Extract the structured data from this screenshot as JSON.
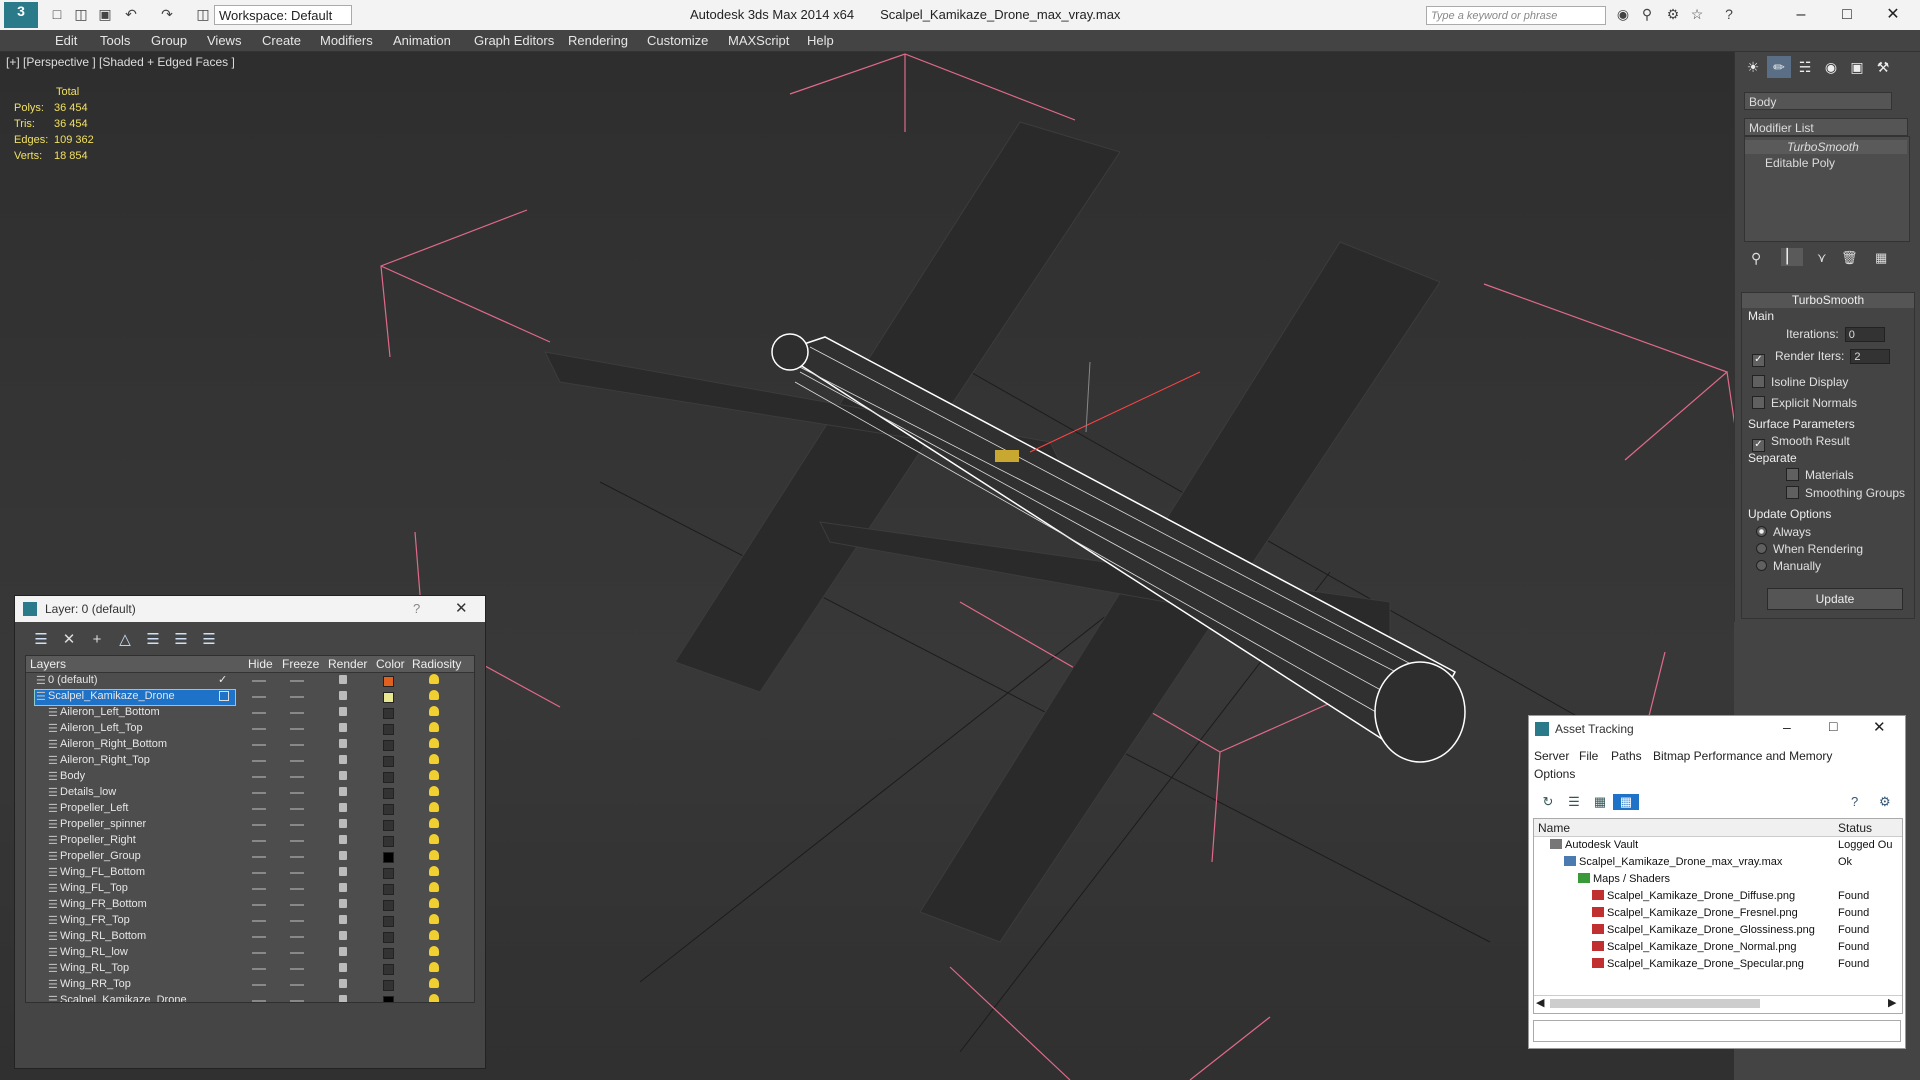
{
  "titlebar": {
    "workspace": "Workspace: Default",
    "app": "Autodesk 3ds Max  2014 x64",
    "file": "Scalpel_Kamikaze_Drone_max_vray.max",
    "search_placeholder": "Type a keyword or phrase"
  },
  "menu": [
    "Edit",
    "Tools",
    "Group",
    "Views",
    "Create",
    "Modifiers",
    "Animation",
    "Graph Editors",
    "Rendering",
    "Customize",
    "MAXScript",
    "Help"
  ],
  "viewport": {
    "label": "[+] [Perspective ] [Shaded + Edged Faces ]",
    "stats": {
      "header": "Total",
      "rows": [
        {
          "label": "Polys:",
          "value": "36 454"
        },
        {
          "label": "Tris:",
          "value": "36 454"
        },
        {
          "label": "Edges:",
          "value": "109 362"
        },
        {
          "label": "Verts:",
          "value": "18 854"
        }
      ]
    }
  },
  "command_panel": {
    "object_name": "Body",
    "modifier_list": "Modifier List",
    "stack": [
      "TurboSmooth",
      "Editable Poly"
    ],
    "rollout_title": "TurboSmooth",
    "main_label": "Main",
    "iterations_label": "Iterations:",
    "iterations_value": "0",
    "render_iters_label": "Render Iters:",
    "render_iters_value": "2",
    "isoline": "Isoline Display",
    "explicit_normals": "Explicit Normals",
    "surface_params": "Surface Parameters",
    "smooth_result": "Smooth Result",
    "separate": "Separate",
    "materials": "Materials",
    "smoothing_groups": "Smoothing Groups",
    "update_options": "Update Options",
    "always": "Always",
    "when_rendering": "When Rendering",
    "manually": "Manually",
    "update_button": "Update"
  },
  "layer_window": {
    "title": "Layer: 0 (default)",
    "columns": [
      "Layers",
      "Hide",
      "Freeze",
      "Render",
      "Color",
      "Radiosity"
    ],
    "layers": [
      {
        "name": "0 (default)",
        "color": "#e06020"
      },
      {
        "name": "Scalpel_Kamikaze_Drone",
        "color": "#e8e890"
      },
      {
        "name": "Aileron_Left_Bottom",
        "color": "#333333"
      },
      {
        "name": "Aileron_Left_Top",
        "color": "#333333"
      },
      {
        "name": "Aileron_Right_Bottom",
        "color": "#333333"
      },
      {
        "name": "Aileron_Right_Top",
        "color": "#333333"
      },
      {
        "name": "Body",
        "color": "#333333"
      },
      {
        "name": "Details_low",
        "color": "#333333"
      },
      {
        "name": "Propeller_Left",
        "color": "#333333"
      },
      {
        "name": "Propeller_spinner",
        "color": "#333333"
      },
      {
        "name": "Propeller_Right",
        "color": "#333333"
      },
      {
        "name": "Propeller_Group",
        "color": "#000000"
      },
      {
        "name": "Wing_FL_Bottom",
        "color": "#333333"
      },
      {
        "name": "Wing_FL_Top",
        "color": "#333333"
      },
      {
        "name": "Wing_FR_Bottom",
        "color": "#333333"
      },
      {
        "name": "Wing_FR_Top",
        "color": "#333333"
      },
      {
        "name": "Wing_RL_Bottom",
        "color": "#333333"
      },
      {
        "name": "Wing_RL_low",
        "color": "#333333"
      },
      {
        "name": "Wing_RL_Top",
        "color": "#333333"
      },
      {
        "name": "Wing_RR_Top",
        "color": "#333333"
      },
      {
        "name": "Scalpel_Kamikaze_Drone",
        "color": "#000000"
      }
    ]
  },
  "asset_window": {
    "title": "Asset Tracking",
    "menu": [
      "Server",
      "File",
      "Paths",
      "Bitmap Performance and Memory"
    ],
    "menu2": "Options",
    "columns": [
      "Name",
      "Status"
    ],
    "rows": [
      {
        "name": "Autodesk Vault",
        "status": "Logged Ou"
      },
      {
        "name": "Scalpel_Kamikaze_Drone_max_vray.max",
        "status": "Ok"
      },
      {
        "name": "Maps / Shaders",
        "status": ""
      },
      {
        "name": "Scalpel_Kamikaze_Drone_Diffuse.png",
        "status": "Found"
      },
      {
        "name": "Scalpel_Kamikaze_Drone_Fresnel.png",
        "status": "Found"
      },
      {
        "name": "Scalpel_Kamikaze_Drone_Glossiness.png",
        "status": "Found"
      },
      {
        "name": "Scalpel_Kamikaze_Drone_Normal.png",
        "status": "Found"
      },
      {
        "name": "Scalpel_Kamikaze_Drone_Specular.png",
        "status": "Found"
      }
    ]
  }
}
